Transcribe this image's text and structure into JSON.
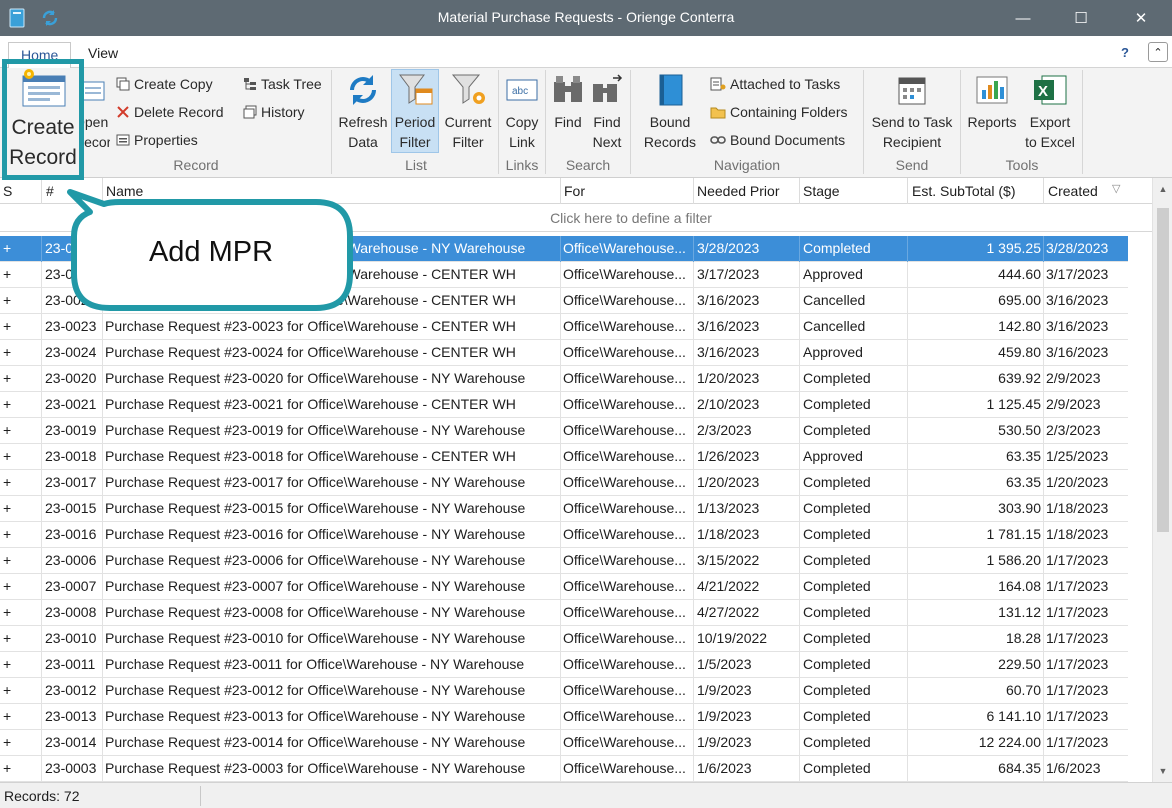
{
  "window": {
    "title": "Material Purchase Requests - Orienge Conterra"
  },
  "tabs": [
    {
      "label": "Home"
    },
    {
      "label": "View"
    }
  ],
  "ribbon": {
    "record": {
      "create": "Create Record",
      "open": "Open Record",
      "create_copy": "Create Copy",
      "delete": "Delete Record",
      "properties": "Properties",
      "task_tree": "Task Tree",
      "history": "History",
      "label": "Record"
    },
    "list": {
      "refresh": "Refresh Data",
      "period": "Period Filter",
      "current": "Current Filter",
      "label": "List"
    },
    "links": {
      "copy": "Copy Link",
      "label": "Links"
    },
    "search": {
      "find": "Find",
      "find_next": "Find Next",
      "label": "Search"
    },
    "navigation": {
      "bound_records": "Bound Records",
      "attached": "Attached to Tasks",
      "containing": "Containing Folders",
      "bound_docs": "Bound Documents",
      "label": "Navigation"
    },
    "send": {
      "send_task": "Send to Task Recipient",
      "label": "Send"
    },
    "tools": {
      "reports": "Reports",
      "export": "Export to Excel",
      "label": "Tools"
    }
  },
  "grid": {
    "columns": [
      "S",
      "#",
      "Name",
      "For",
      "Needed Prior",
      "Stage",
      "Est. SubTotal ($)",
      "Created"
    ],
    "filter_hint": "Click here to define a filter",
    "rows": [
      {
        "s": "+",
        "id": "23-0025",
        "name": "Purchase Request #23-0025 for Office\\Warehouse - NY Warehouse",
        "for": "Office\\Warehouse",
        "needed": "3/28/2023",
        "stage": "Completed",
        "total": "1 395.25",
        "created": "3/28/2023"
      },
      {
        "s": "+",
        "id": "23-0026",
        "name": "Purchase Request #23-0026 for Office\\Warehouse - CENTER WH",
        "for": "Office\\Warehouse",
        "needed": "3/17/2023",
        "stage": "Approved",
        "total": "444.60",
        "created": "3/17/2023"
      },
      {
        "s": "+",
        "id": "23-0022",
        "name": "Purchase Request #23-0022 for Office\\Warehouse - CENTER WH",
        "for": "Office\\Warehouse",
        "needed": "3/16/2023",
        "stage": "Cancelled",
        "total": "695.00",
        "created": "3/16/2023"
      },
      {
        "s": "+",
        "id": "23-0023",
        "name": "Purchase Request #23-0023 for Office\\Warehouse - CENTER WH",
        "for": "Office\\Warehouse",
        "needed": "3/16/2023",
        "stage": "Cancelled",
        "total": "142.80",
        "created": "3/16/2023"
      },
      {
        "s": "+",
        "id": "23-0024",
        "name": "Purchase Request #23-0024 for Office\\Warehouse - CENTER WH",
        "for": "Office\\Warehouse",
        "needed": "3/16/2023",
        "stage": "Approved",
        "total": "459.80",
        "created": "3/16/2023"
      },
      {
        "s": "+",
        "id": "23-0020",
        "name": "Purchase Request #23-0020 for Office\\Warehouse - NY Warehouse",
        "for": "Office\\Warehouse",
        "needed": "1/20/2023",
        "stage": "Completed",
        "total": "639.92",
        "created": "2/9/2023"
      },
      {
        "s": "+",
        "id": "23-0021",
        "name": "Purchase Request #23-0021 for Office\\Warehouse - CENTER WH",
        "for": "Office\\Warehouse",
        "needed": "2/10/2023",
        "stage": "Completed",
        "total": "1 125.45",
        "created": "2/9/2023"
      },
      {
        "s": "+",
        "id": "23-0019",
        "name": "Purchase Request #23-0019 for Office\\Warehouse - NY Warehouse",
        "for": "Office\\Warehouse",
        "needed": "2/3/2023",
        "stage": "Completed",
        "total": "530.50",
        "created": "2/3/2023"
      },
      {
        "s": "+",
        "id": "23-0018",
        "name": "Purchase Request #23-0018 for Office\\Warehouse - CENTER WH",
        "for": "Office\\Warehouse",
        "needed": "1/26/2023",
        "stage": "Approved",
        "total": "63.35",
        "created": "1/25/2023"
      },
      {
        "s": "+",
        "id": "23-0017",
        "name": "Purchase Request #23-0017 for Office\\Warehouse - NY Warehouse",
        "for": "Office\\Warehouse",
        "needed": "1/20/2023",
        "stage": "Completed",
        "total": "63.35",
        "created": "1/20/2023"
      },
      {
        "s": "+",
        "id": "23-0015",
        "name": "Purchase Request #23-0015 for Office\\Warehouse - NY Warehouse",
        "for": "Office\\Warehouse",
        "needed": "1/13/2023",
        "stage": "Completed",
        "total": "303.90",
        "created": "1/18/2023"
      },
      {
        "s": "+",
        "id": "23-0016",
        "name": "Purchase Request #23-0016 for Office\\Warehouse - NY Warehouse",
        "for": "Office\\Warehouse",
        "needed": "1/18/2023",
        "stage": "Completed",
        "total": "1 781.15",
        "created": "1/18/2023"
      },
      {
        "s": "+",
        "id": "23-0006",
        "name": "Purchase Request #23-0006 for Office\\Warehouse - NY Warehouse",
        "for": "Office\\Warehouse",
        "needed": "3/15/2022",
        "stage": "Completed",
        "total": "1 586.20",
        "created": "1/17/2023"
      },
      {
        "s": "+",
        "id": "23-0007",
        "name": "Purchase Request #23-0007 for Office\\Warehouse - NY Warehouse",
        "for": "Office\\Warehouse",
        "needed": "4/21/2022",
        "stage": "Completed",
        "total": "164.08",
        "created": "1/17/2023"
      },
      {
        "s": "+",
        "id": "23-0008",
        "name": "Purchase Request #23-0008 for Office\\Warehouse - NY Warehouse",
        "for": "Office\\Warehouse",
        "needed": "4/27/2022",
        "stage": "Completed",
        "total": "131.12",
        "created": "1/17/2023"
      },
      {
        "s": "+",
        "id": "23-0010",
        "name": "Purchase Request #23-0010 for Office\\Warehouse - NY Warehouse",
        "for": "Office\\Warehouse",
        "needed": "10/19/2022",
        "stage": "Completed",
        "total": "18.28",
        "created": "1/17/2023"
      },
      {
        "s": "+",
        "id": "23-0011",
        "name": "Purchase Request #23-0011 for Office\\Warehouse - NY Warehouse",
        "for": "Office\\Warehouse",
        "needed": "1/5/2023",
        "stage": "Completed",
        "total": "229.50",
        "created": "1/17/2023"
      },
      {
        "s": "+",
        "id": "23-0012",
        "name": "Purchase Request #23-0012 for Office\\Warehouse - NY Warehouse",
        "for": "Office\\Warehouse",
        "needed": "1/9/2023",
        "stage": "Completed",
        "total": "60.70",
        "created": "1/17/2023"
      },
      {
        "s": "+",
        "id": "23-0013",
        "name": "Purchase Request #23-0013 for Office\\Warehouse - NY Warehouse",
        "for": "Office\\Warehouse",
        "needed": "1/9/2023",
        "stage": "Completed",
        "total": "6 141.10",
        "created": "1/17/2023"
      },
      {
        "s": "+",
        "id": "23-0014",
        "name": "Purchase Request #23-0014 for Office\\Warehouse - NY Warehouse",
        "for": "Office\\Warehouse",
        "needed": "1/9/2023",
        "stage": "Completed",
        "total": "12 224.00",
        "created": "1/17/2023"
      },
      {
        "s": "+",
        "id": "23-0003",
        "name": "Purchase Request #23-0003 for Office\\Warehouse - NY Warehouse",
        "for": "Office\\Warehouse",
        "needed": "1/6/2023",
        "stage": "Completed",
        "total": "684.35",
        "created": "1/6/2023"
      }
    ]
  },
  "status": {
    "records": "Records: 72"
  },
  "annotation": {
    "callout": "Add MPR"
  },
  "colors": {
    "accent": "#2199a7",
    "selection": "#3c8ed8",
    "titlebar": "#5e6a73"
  },
  "icons": [
    "app-icon",
    "refresh-icon",
    "minimize-icon",
    "maximize-icon",
    "close-icon",
    "help-icon",
    "filter-icon",
    "excel-icon",
    "chart-icon",
    "binoculars-icon",
    "book-icon",
    "folder-icon",
    "link-icon"
  ]
}
